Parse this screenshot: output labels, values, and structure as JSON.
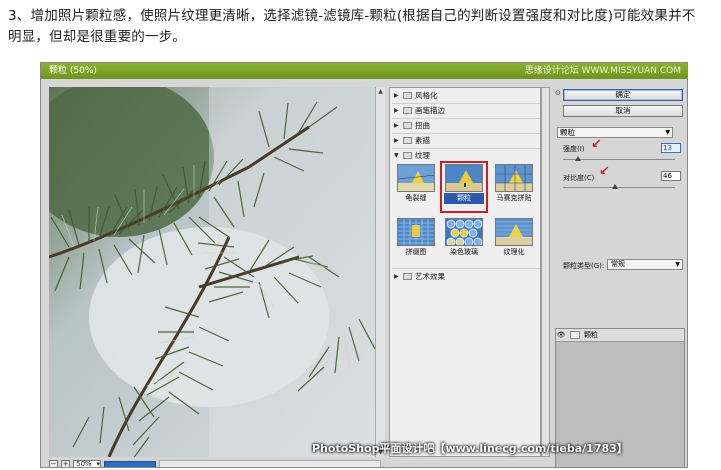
{
  "caption": {
    "line1": "3、增加照片颗粒感，使照片纹理更清晰，选择滤镜-滤镜库-颗粒(根据自己的判断设置强度和对比度)可能效果并不",
    "line2": "明显，但却是很重要的一步。"
  },
  "window": {
    "title": "颗粒 (50%)",
    "watermark": "思缘设计论坛  WWW.MISSYUAN.COM"
  },
  "statusbar": {
    "minus": "−",
    "plus": "+",
    "zoom": "50%",
    "zoom_arrow": "▾"
  },
  "gallery": {
    "folders": [
      {
        "label": "风格化",
        "expanded": false
      },
      {
        "label": "画笔描边",
        "expanded": false
      },
      {
        "label": "扭曲",
        "expanded": false
      },
      {
        "label": "素描",
        "expanded": false
      },
      {
        "label": "纹理",
        "expanded": true
      }
    ],
    "texture_items": [
      "龟裂缝",
      "颗粒",
      "马赛克拼贴",
      "拼缀图",
      "染色玻璃",
      "纹理化"
    ],
    "selected": "颗粒",
    "last_folder": {
      "label": "艺术效果",
      "expanded": false
    }
  },
  "panel": {
    "ok": "确定",
    "cancel": "取消",
    "filter_select": "颗粒",
    "intensity_label": "强度(I)",
    "intensity_value": "13",
    "intensity_level": 0.13,
    "contrast_label": "对比度(C)",
    "contrast_value": "46",
    "contrast_level": 0.46,
    "grain_type_label": "颗粒类型(G):",
    "grain_type_value": "常规",
    "layer_name": "颗粒"
  },
  "footer_watermark": "PhotoShop平面设计吧【www.linecg.com/tieba/1783】",
  "colors": {
    "titlebar": "#7aa323",
    "selection_box": "#c6202a",
    "annotation_arrow": "#d21f27",
    "progress": "#2a6fc6"
  }
}
